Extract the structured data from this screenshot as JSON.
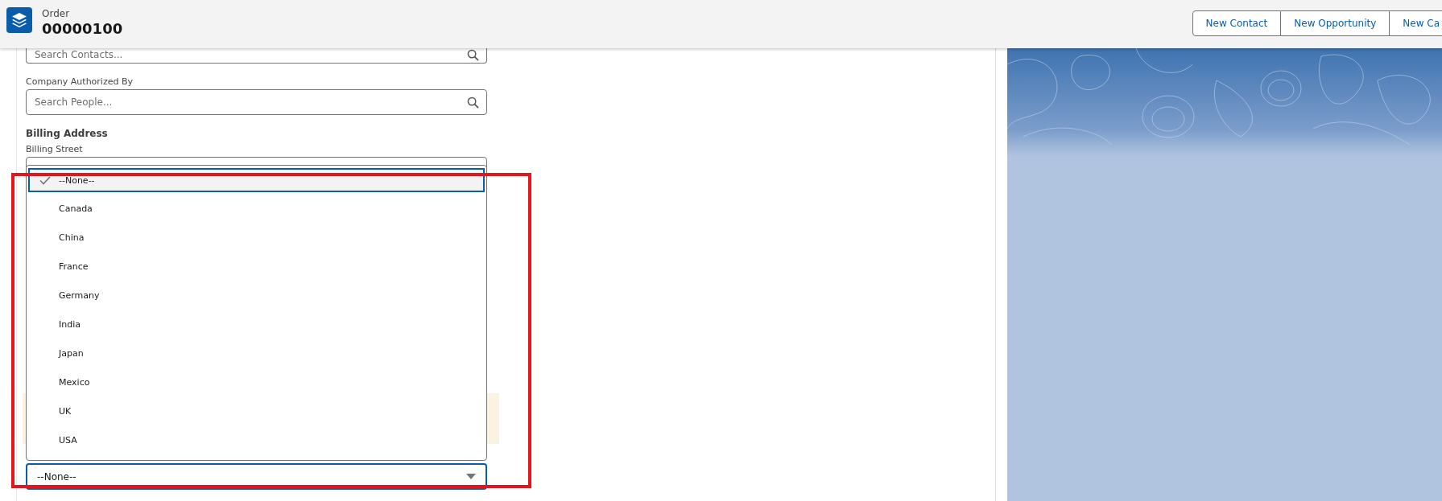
{
  "header": {
    "object_label": "Order",
    "record_number": "00000100",
    "actions": [
      "New Contact",
      "New Opportunity",
      "New Ca"
    ]
  },
  "form": {
    "contacts_field": {
      "placeholder": "Search Contacts..."
    },
    "authorized_by": {
      "label": "Company Authorized By",
      "placeholder": "Search People..."
    },
    "billing_address": {
      "heading": "Billing Address",
      "street_label": "Billing Street"
    },
    "country_select": {
      "value": "--None--",
      "expanded": true,
      "options": [
        {
          "label": "--None--",
          "selected": true
        },
        {
          "label": "Canada",
          "selected": false
        },
        {
          "label": "China",
          "selected": false
        },
        {
          "label": "France",
          "selected": false
        },
        {
          "label": "Germany",
          "selected": false
        },
        {
          "label": "India",
          "selected": false
        },
        {
          "label": "Japan",
          "selected": false
        },
        {
          "label": "Mexico",
          "selected": false
        },
        {
          "label": "UK",
          "selected": false
        },
        {
          "label": "USA",
          "selected": false
        }
      ]
    }
  }
}
